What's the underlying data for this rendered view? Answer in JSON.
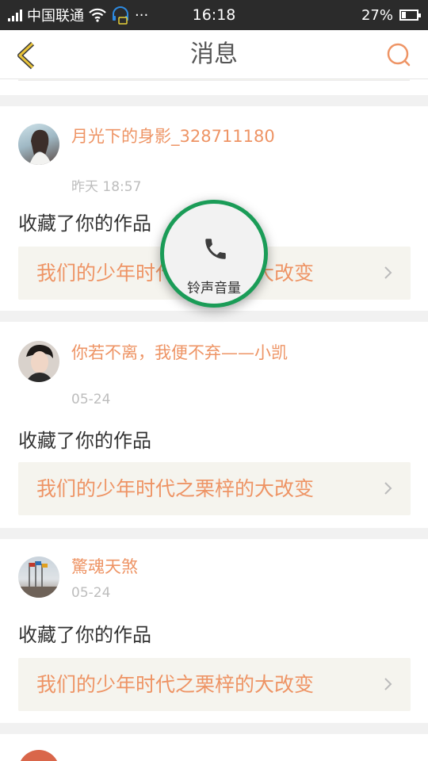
{
  "status_bar": {
    "carrier": "中国联通",
    "extra": "···",
    "time": "16:18",
    "battery": "27%",
    "battery_level": 0.27
  },
  "header": {
    "title": "消息",
    "back_icon": "chevron-left-icon",
    "search_icon": "search-icon"
  },
  "notifications": [
    {
      "user": "月光下的身影_328711180",
      "time": "昨天 18:57",
      "action": "收藏了你的作品",
      "work_title": "我们的少年时代之栗梓的大改变"
    },
    {
      "user": "你若不离，我便不弃——小凯",
      "time": "05-24",
      "action": "收藏了你的作品",
      "work_title": "我们的少年时代之栗梓的大改变"
    },
    {
      "user": "驚魂天煞",
      "time": "05-24",
      "action": "收藏了你的作品",
      "work_title": "我们的少年时代之栗梓的大改变"
    }
  ],
  "overlay": {
    "label": "铃声音量",
    "icon": "phone-icon"
  },
  "colors": {
    "accent": "#ee9465",
    "link_bg": "#f5f4ee",
    "overlay_ring": "#1a9c57",
    "status_bar": "#2b2b2b"
  }
}
